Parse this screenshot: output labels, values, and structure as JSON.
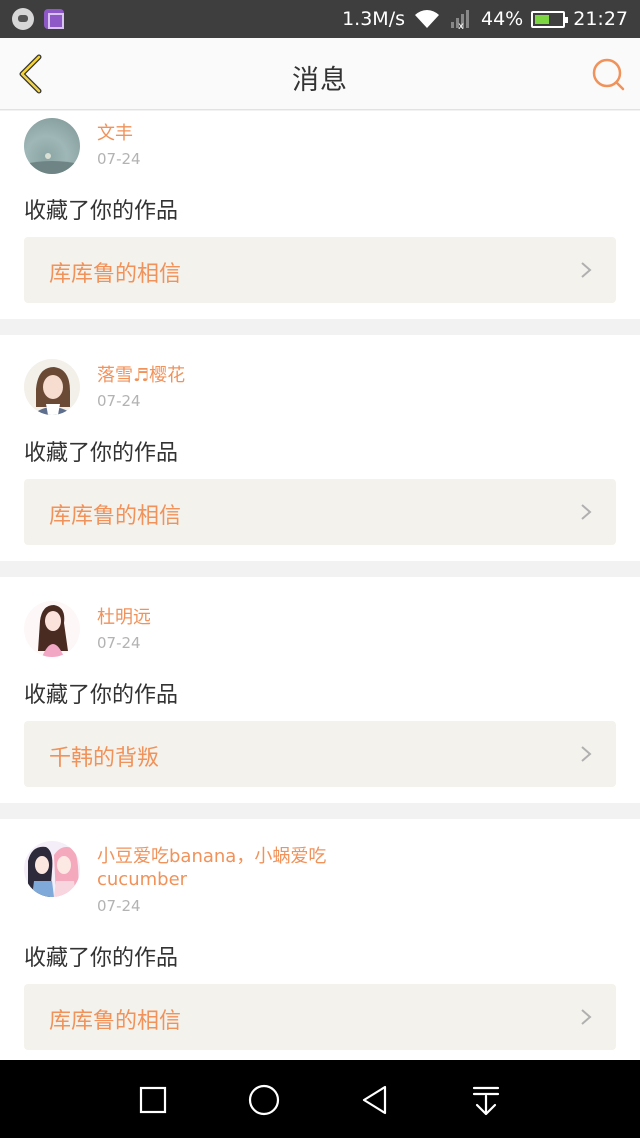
{
  "status_bar": {
    "speed": "1.3M/s",
    "battery": "44%",
    "time": "21:27"
  },
  "header": {
    "title": "消息"
  },
  "notifications": [
    {
      "user": "文丰",
      "date": "07-24",
      "action": "收藏了你的作品",
      "work": "库库鲁的相信"
    },
    {
      "user": "落雪♬樱花",
      "date": "07-24",
      "action": "收藏了你的作品",
      "work": "库库鲁的相信"
    },
    {
      "user": "杜明远",
      "date": "07-24",
      "action": "收藏了你的作品",
      "work": "千韩的背叛"
    },
    {
      "user": "小豆爱吃banana，小蜗爱吃cucumber",
      "date": "07-24",
      "action": "收藏了你的作品",
      "work": "库库鲁的相信"
    }
  ],
  "colors": {
    "accent": "#f0925a",
    "back_arrow": "#f3d23a",
    "status_bar": "#3e3e3e",
    "card_link_bg": "#f4f2ec"
  },
  "icons": {
    "back": "back-arrow-icon",
    "search": "search-icon",
    "chevron": "chevron-right-icon",
    "nav": [
      "recent-apps-icon",
      "home-icon",
      "back-icon",
      "notification-drawer-icon"
    ]
  }
}
